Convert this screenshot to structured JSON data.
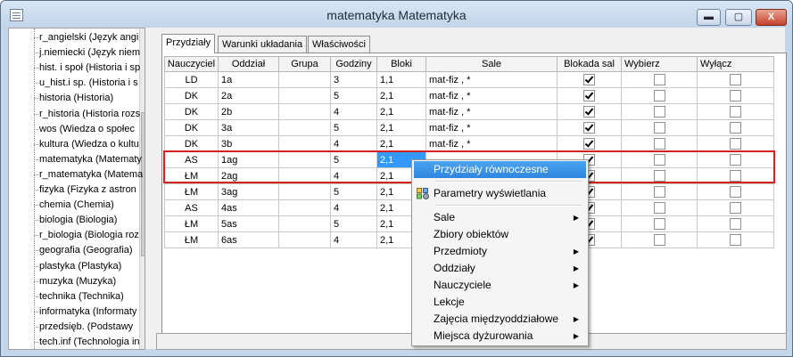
{
  "window": {
    "title": "matematyka Matematyka",
    "minimize": "▬",
    "maximize": "▢",
    "close": "X"
  },
  "tree": {
    "items": [
      "r_angielski (Język angi",
      "j.niemiecki (Język niem",
      "hist. i społ (Historia i sp",
      "u_hist.i sp. (Historia i s",
      "historia (Historia)",
      "r_historia (Historia rozs",
      "wos (Wiedza o społec",
      "kultura (Wiedza o kultu",
      "matematyka (Matematy",
      "r_matematyka (Matema",
      "fizyka (Fizyka z astron",
      "chemia (Chemia)",
      "biologia (Biologia)",
      "r_biologia (Biologia roz",
      "geografia (Geografia)",
      "plastyka (Plastyka)",
      "muzyka (Muzyka)",
      "technika (Technika)",
      "informatyka (Informaty",
      "przedsięb. (Podstawy",
      "tech.inf (Technologia in"
    ]
  },
  "tabs": [
    {
      "label": "Przydziały"
    },
    {
      "label": "Warunki układania"
    },
    {
      "label": "Właściwości"
    }
  ],
  "table": {
    "headers": [
      "Nauczyciel",
      "Oddział",
      "Grupa",
      "Godziny",
      "Bloki",
      "Sale",
      "Blokada sal",
      "Wybierz",
      "Wyłącz"
    ],
    "rows": [
      {
        "nauczyciel": "LD",
        "oddzial": "1a",
        "grupa": "",
        "godziny": "3",
        "bloki": "1,1",
        "sale": "mat-fiz , *",
        "blokada": true,
        "wybierz": false,
        "wylacz": false
      },
      {
        "nauczyciel": "DK",
        "oddzial": "2a",
        "grupa": "",
        "godziny": "5",
        "bloki": "2,1",
        "sale": "mat-fiz , *",
        "blokada": true,
        "wybierz": false,
        "wylacz": false
      },
      {
        "nauczyciel": "DK",
        "oddzial": "2b",
        "grupa": "",
        "godziny": "4",
        "bloki": "2,1",
        "sale": "mat-fiz , *",
        "blokada": true,
        "wybierz": false,
        "wylacz": false
      },
      {
        "nauczyciel": "DK",
        "oddzial": "3a",
        "grupa": "",
        "godziny": "5",
        "bloki": "2,1",
        "sale": "mat-fiz , *",
        "blokada": true,
        "wybierz": false,
        "wylacz": false
      },
      {
        "nauczyciel": "DK",
        "oddzial": "3b",
        "grupa": "",
        "godziny": "4",
        "bloki": "2,1",
        "sale": "mat-fiz , *",
        "blokada": true,
        "wybierz": false,
        "wylacz": false
      },
      {
        "nauczyciel": "AS",
        "oddzial": "1ag",
        "grupa": "",
        "godziny": "5",
        "bloki": "2,1",
        "sale": "",
        "blokada": true,
        "wybierz": false,
        "wylacz": false,
        "selected": true
      },
      {
        "nauczyciel": "ŁM",
        "oddzial": "2ag",
        "grupa": "",
        "godziny": "4",
        "bloki": "2,1",
        "sale": "",
        "blokada": true,
        "wybierz": false,
        "wylacz": false
      },
      {
        "nauczyciel": "ŁM",
        "oddzial": "3ag",
        "grupa": "",
        "godziny": "5",
        "bloki": "2,1",
        "sale": "",
        "blokada": true,
        "wybierz": false,
        "wylacz": false
      },
      {
        "nauczyciel": "AS",
        "oddzial": "4as",
        "grupa": "",
        "godziny": "4",
        "bloki": "2,1",
        "sale": "",
        "blokada": true,
        "wybierz": false,
        "wylacz": false
      },
      {
        "nauczyciel": "ŁM",
        "oddzial": "5as",
        "grupa": "",
        "godziny": "5",
        "bloki": "2,1",
        "sale": "",
        "blokada": true,
        "wybierz": false,
        "wylacz": false
      },
      {
        "nauczyciel": "ŁM",
        "oddzial": "6as",
        "grupa": "",
        "godziny": "4",
        "bloki": "2,1",
        "sale": "",
        "blokada": true,
        "wybierz": false,
        "wylacz": false
      }
    ]
  },
  "context_menu": {
    "items": [
      {
        "label": "Przydziały równoczesne",
        "highlighted": true,
        "submenu": false
      },
      {
        "separator": true
      },
      {
        "label": "Parametry wyświetlania",
        "icon": "display-params-icon",
        "submenu": false
      },
      {
        "separator": true
      },
      {
        "label": "Sale",
        "submenu": true
      },
      {
        "label": "Zbiory obiektów",
        "submenu": false
      },
      {
        "label": "Przedmioty",
        "submenu": true
      },
      {
        "label": "Oddziały",
        "submenu": true
      },
      {
        "label": "Nauczyciele",
        "submenu": true
      },
      {
        "label": "Lekcje",
        "submenu": false
      },
      {
        "label": "Zajęcia międzyoddziałowe",
        "submenu": true
      },
      {
        "label": "Miejsca dyżurowania",
        "submenu": true
      }
    ]
  },
  "colors": {
    "selection": "#3399ff",
    "highlight_box": "#d42020",
    "menu_highlight": "#3a92e6"
  }
}
